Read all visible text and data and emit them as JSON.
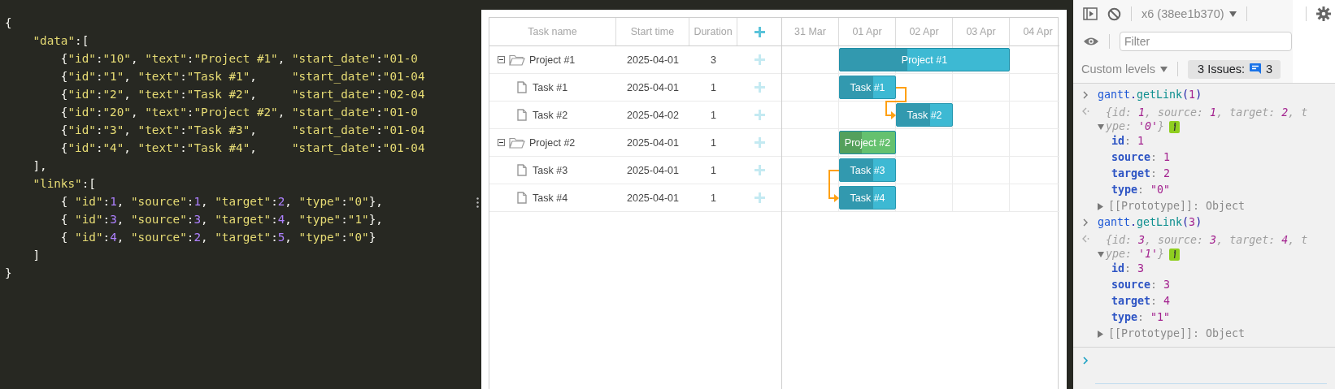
{
  "editor": {
    "lines": [
      "{",
      "    \"data\":[",
      "        {\"id\":\"10\", \"text\":\"Project #1\", \"start_date\":\"01-0",
      "        {\"id\":\"1\", \"text\":\"Task #1\",     \"start_date\":\"01-04",
      "        {\"id\":\"2\", \"text\":\"Task #2\",     \"start_date\":\"02-04",
      "        {\"id\":\"20\", \"text\":\"Project #2\", \"start_date\":\"01-0",
      "        {\"id\":\"3\", \"text\":\"Task #3\",     \"start_date\":\"01-04",
      "        {\"id\":\"4\", \"text\":\"Task #4\",     \"start_date\":\"01-04",
      "    ],",
      "    \"links\":[",
      "        { \"id\":1, \"source\":1, \"target\":2, \"type\":\"0\"},",
      "        { \"id\":3, \"source\":3, \"target\":4, \"type\":\"1\"},",
      "        { \"id\":4, \"source\":2, \"target\":5, \"type\":\"0\"}",
      "    ]",
      "}"
    ]
  },
  "gantt": {
    "columns": [
      {
        "kind": "name",
        "label": "Task name"
      },
      {
        "kind": "start",
        "label": "Start time"
      },
      {
        "kind": "duration",
        "label": "Duration"
      },
      {
        "kind": "add"
      }
    ],
    "scale": [
      "31 Mar",
      "01 Apr",
      "02 Apr",
      "03 Apr",
      "04 Apr"
    ],
    "rows": [
      {
        "kind": "project",
        "text": "Project #1",
        "start": "2025-04-01",
        "duration": "3",
        "expanded": true,
        "bar_label": "Project #1",
        "level": 0.4,
        "color": "#3db9d3",
        "children": [
          {
            "kind": "task",
            "text": "Task #1",
            "start": "2025-04-01",
            "duration": "1",
            "bar_label": "Task #1",
            "level": 0.6,
            "color": "#3db9d3"
          },
          {
            "kind": "task",
            "text": "Task #2",
            "start": "2025-04-02",
            "duration": "1",
            "bar_label": "Task #2",
            "level": 0.6,
            "color": "#3db9d3",
            "incoming_link": {
              "kind": "finish_to_start"
            }
          }
        ]
      },
      {
        "kind": "project",
        "text": "Project #2",
        "start": "2025-04-01",
        "duration": "1",
        "expanded": true,
        "bar_label": "Project #2",
        "level": 0.4,
        "color": "#65c16f",
        "children": [
          {
            "kind": "task",
            "text": "Task #3",
            "start": "2025-04-01",
            "duration": "1",
            "bar_label": "Task #3",
            "level": 0.6,
            "color": "#3db9d3"
          },
          {
            "kind": "task",
            "text": "Task #4",
            "start": "2025-04-01",
            "duration": "1",
            "bar_label": "Task #4",
            "level": 0.6,
            "color": "#3db9d3",
            "incoming_link": {
              "kind": "start_to_start"
            }
          }
        ]
      }
    ]
  },
  "console": {
    "context": "x6 (38ee1b370)",
    "filter": {
      "placeholder": "Filter"
    },
    "levels": "Custom levels",
    "issues": {
      "label": "3 Issues:",
      "count": "3"
    },
    "entries": [
      {
        "command": "gantt.getLink(1)",
        "summary": "{id: 1, source: 1, target: 2, type: '0'}",
        "expanded": true,
        "properties": [
          "id: 1",
          "source: 1",
          "target: 2",
          "type: \"0\""
        ],
        "prototype": "[[Prototype]]: Object"
      },
      {
        "command": "gantt.getLink(3)",
        "summary": "{id: 3, source: 3, target: 4, type: '1'}",
        "expanded": true,
        "properties": [
          "id: 3",
          "source: 3",
          "target: 4",
          "type: \"1\""
        ],
        "prototype": "[[Prototype]]: Object"
      }
    ]
  }
}
